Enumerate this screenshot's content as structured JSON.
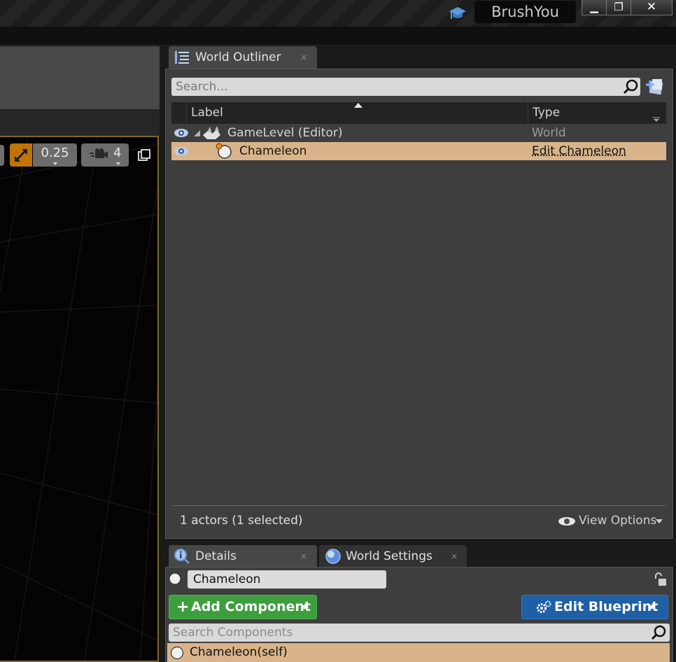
{
  "titlebar": {
    "project_name": "BrushYou",
    "minimize_glyph": "▁",
    "maximize_glyph": "❐",
    "close_glyph": "✕"
  },
  "viewport": {
    "scale_snap_value": "0.25",
    "camera_speed": "4"
  },
  "world_outliner": {
    "tab_label": "World Outliner",
    "tab_close": "×",
    "search_placeholder": "Search...",
    "columns": {
      "label": "Label",
      "type": "Type"
    },
    "rows": [
      {
        "label": "GameLevel (Editor)",
        "type": "World"
      },
      {
        "label": "Chameleon",
        "type": "Edit Chameleon"
      }
    ],
    "status": "1 actors (1 selected)",
    "view_options": "View Options"
  },
  "details": {
    "tabs": [
      {
        "label": "Details",
        "close": "×"
      },
      {
        "label": "World Settings",
        "close": "×"
      }
    ],
    "actor_name": "Chameleon",
    "add_component": {
      "plus": "+",
      "label": "Add Component"
    },
    "edit_blueprint": {
      "label": "Edit Blueprint"
    },
    "component_search_placeholder": "Search Components",
    "components": [
      {
        "label": "Chameleon(self)"
      }
    ]
  },
  "colors": {
    "selection": "#d9b48a",
    "add_component_green": "#3c9e3c",
    "edit_blueprint_blue": "#1f5fa5",
    "viewport_border": "#7a6730",
    "snap_orange": "#c07408"
  }
}
